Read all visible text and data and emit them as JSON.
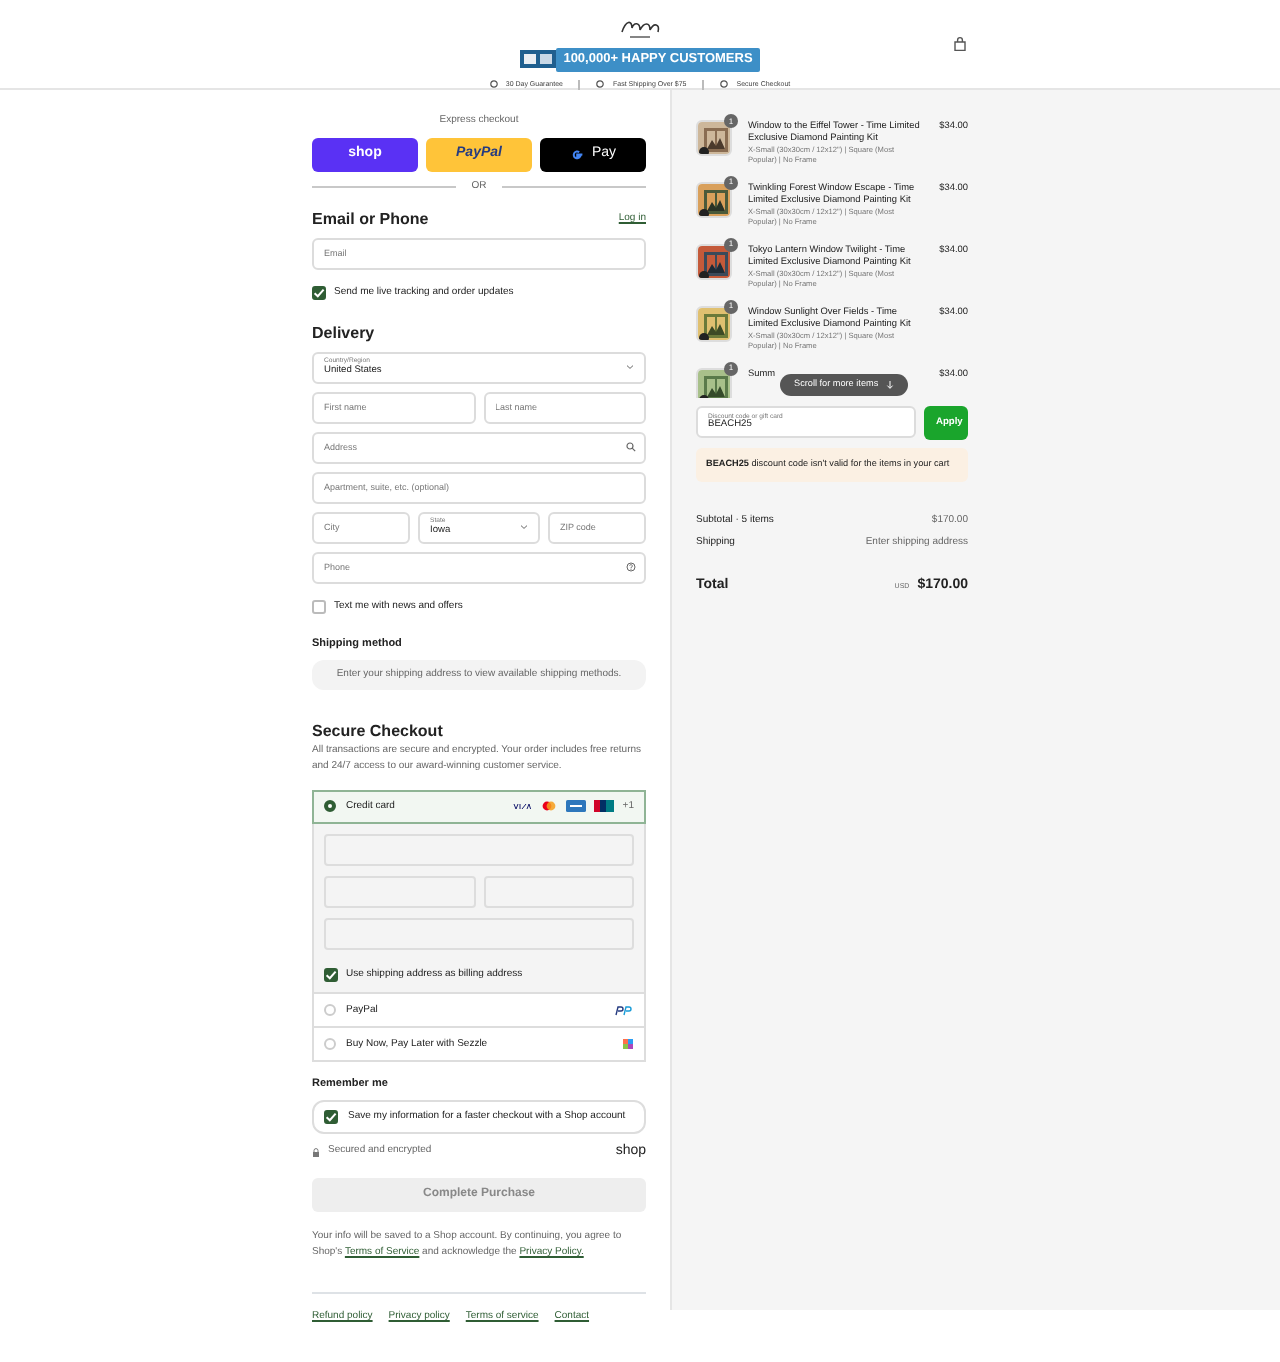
{
  "header": {
    "banner": "100,000+ HAPPY CUSTOMERS",
    "badges": [
      "30 Day Guarantee",
      "Fast Shipping Over $75",
      "Secure Checkout"
    ]
  },
  "express": {
    "title": "Express checkout",
    "buttons": [
      {
        "kind": "shop",
        "label": "shop"
      },
      {
        "kind": "paypal",
        "label": "PayPal"
      },
      {
        "kind": "gpay",
        "label": "Pay"
      }
    ],
    "separator": "OR"
  },
  "contact": {
    "title": "Email or Phone",
    "login": "Log in",
    "email_placeholder": "Email",
    "updates": {
      "label": "Send me live tracking and order updates",
      "checked": true
    }
  },
  "delivery": {
    "title": "Delivery",
    "rows": [
      [
        {
          "kind": "select",
          "label": "Country/Region",
          "value": "United States"
        }
      ],
      [
        {
          "kind": "text",
          "placeholder": "First name"
        },
        {
          "kind": "text",
          "placeholder": "Last name"
        }
      ],
      [
        {
          "kind": "search",
          "placeholder": "Address"
        }
      ],
      [
        {
          "kind": "text",
          "placeholder": "Apartment, suite, etc. (optional)"
        }
      ],
      [
        {
          "kind": "text",
          "placeholder": "City"
        },
        {
          "kind": "select",
          "label": "State",
          "value": "Iowa"
        },
        {
          "kind": "text",
          "placeholder": "ZIP code"
        }
      ],
      [
        {
          "kind": "help",
          "placeholder": "Phone"
        }
      ]
    ],
    "offers": {
      "label": "Text me with news and offers",
      "checked": false
    }
  },
  "shipping": {
    "title": "Shipping method",
    "note": "Enter your shipping address to view available shipping methods."
  },
  "payment": {
    "title": "Secure Checkout",
    "description": "All transactions are secure and encrypted. Your order includes free returns and 24/7 access to our award-winning customer service.",
    "methods": [
      {
        "kind": "card",
        "label": "Credit card",
        "selected": true,
        "more": "+1"
      },
      {
        "kind": "paypal",
        "label": "PayPal",
        "selected": false
      },
      {
        "kind": "sezzle",
        "label": "Buy Now, Pay Later with Sezzle",
        "selected": false
      }
    ],
    "billing": {
      "label": "Use shipping address as billing address",
      "checked": true
    }
  },
  "remember": {
    "title": "Remember me",
    "save": {
      "label": "Save my information for a faster checkout with a Shop account",
      "checked": true
    },
    "secure": "Secured and encrypted",
    "shop": "shop"
  },
  "submit": {
    "label": "Complete Purchase",
    "disabled": true
  },
  "legal": {
    "text": "Your info will be saved to a Shop account. By continuing, you agree to Shop's",
    "terms": "Terms of Service",
    "middle": "and acknowledge the",
    "privacy": "Privacy Policy."
  },
  "footer_links": [
    "Refund policy",
    "Privacy policy",
    "Terms of service",
    "Contact"
  ],
  "items": [
    {
      "qty": "1",
      "title": "Window to the Eiffel Tower - Time Limited Exclusive Diamond Painting Kit",
      "variant": "X-Small (30x30cm / 12x12\") | Square (Most Popular) | No Frame",
      "price": "$34.00"
    },
    {
      "qty": "1",
      "title": "Twinkling Forest Window Escape - Time Limited Exclusive Diamond Painting Kit",
      "variant": "X-Small (30x30cm / 12x12\") | Square (Most Popular) | No Frame",
      "price": "$34.00"
    },
    {
      "qty": "1",
      "title": "Tokyo Lantern Window Twilight - Time Limited Exclusive Diamond Painting Kit",
      "variant": "X-Small (30x30cm / 12x12\") | Square (Most Popular) | No Frame",
      "price": "$34.00"
    },
    {
      "qty": "1",
      "title": "Window Sunlight Over Fields - Time Limited Exclusive Diamond Painting Kit",
      "variant": "X-Small (30x30cm / 12x12\") | Square (Most Popular) | No Frame",
      "price": "$34.00"
    },
    {
      "qty": "1",
      "title": "Summ",
      "price": "$34.00"
    }
  ],
  "scroll_hint": "Scroll for more items",
  "discount": {
    "label": "Discount code or gift card",
    "value": "BEACH25",
    "button": "Apply"
  },
  "notice": "**BEACH25** discount code isn't valid for the items in your cart",
  "summary": {
    "subtotal_label": "Subtotal · 5 items",
    "subtotal": "$170.00",
    "shipping_label": "Shipping",
    "shipping": "Enter shipping address",
    "total_label": "Total",
    "currency": "USD",
    "total": "$170.00"
  }
}
